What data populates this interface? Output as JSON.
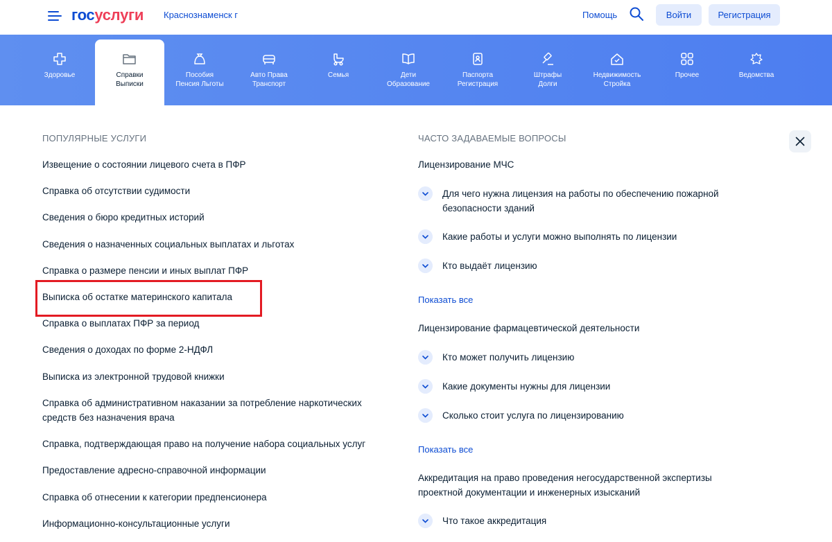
{
  "header": {
    "logo_part1": "гос",
    "logo_part2": "услуги",
    "city": "Краснознаменск г",
    "help": "Помощь",
    "login": "Войти",
    "register": "Регистрация"
  },
  "categories": [
    {
      "line1": "Здоровье",
      "line2": "",
      "icon": "health-cross-icon"
    },
    {
      "line1": "Справки",
      "line2": "Выписки",
      "icon": "folder-icon",
      "active": true
    },
    {
      "line1": "Пособия",
      "line2": "Пенсия Льготы",
      "icon": "wallet-icon"
    },
    {
      "line1": "Авто Права",
      "line2": "Транспорт",
      "icon": "car-icon"
    },
    {
      "line1": "Семья",
      "line2": "",
      "icon": "stroller-icon"
    },
    {
      "line1": "Дети",
      "line2": "Образование",
      "icon": "book-icon"
    },
    {
      "line1": "Паспорта",
      "line2": "Регистрация",
      "icon": "passport-icon"
    },
    {
      "line1": "Штрафы",
      "line2": "Долги",
      "icon": "gavel-icon"
    },
    {
      "line1": "Недвижимость",
      "line2": "Стройка",
      "icon": "house-icon"
    },
    {
      "line1": "Прочее",
      "line2": "",
      "icon": "grid-icon"
    },
    {
      "line1": "Ведомства",
      "line2": "",
      "icon": "emblem-icon"
    }
  ],
  "popular": {
    "title": "ПОПУЛЯРНЫЕ УСЛУГИ",
    "items": [
      "Извещение о состоянии лицевого счета в ПФР",
      "Справка об отсутствии судимости",
      "Сведения о бюро кредитных историй",
      "Сведения о назначенных социальных выплатах и льготах",
      "Справка о размере пенсии и иных выплат ПФР",
      "Выписка об остатке материнского капитала",
      "Справка о выплатах ПФР за период",
      "Сведения о доходах по форме 2-НДФЛ",
      "Выписка из электронной трудовой книжки",
      "Справка об административном наказании за потребление наркотических",
      "средств без назначения врача",
      "Справка, подтверждающая право на получение набора социальных услуг",
      "Предоставление адресно-справочной информации",
      "Справка об отнесении к категории предпенсионера",
      "Информационно-консультационные услуги"
    ]
  },
  "faq": {
    "title": "ЧАСТО ЗАДАВАЕМЫЕ ВОПРОСЫ",
    "show_all": "Показать все",
    "group1": "Лицензирование МЧС",
    "g1q1a": "Для чего нужна лицензия на работы по обеспечению пожарной",
    "g1q1b": "безопасности зданий",
    "g1q2": "Какие работы и услуги можно выполнять по лицензии",
    "g1q3": "Кто выдаёт лицензию",
    "group2": "Лицензирование фармацевтической деятельности",
    "g2q1": "Кто может получить лицензию",
    "g2q2": "Какие документы нужны для лицензии",
    "g2q3": "Сколько стоит услуга по лицензированию",
    "group3a": "Аккредитация на право проведения негосударственной экспертизы",
    "group3b": "проектной документации и инженерных изысканий",
    "g3q1": "Что такое аккредитация"
  }
}
